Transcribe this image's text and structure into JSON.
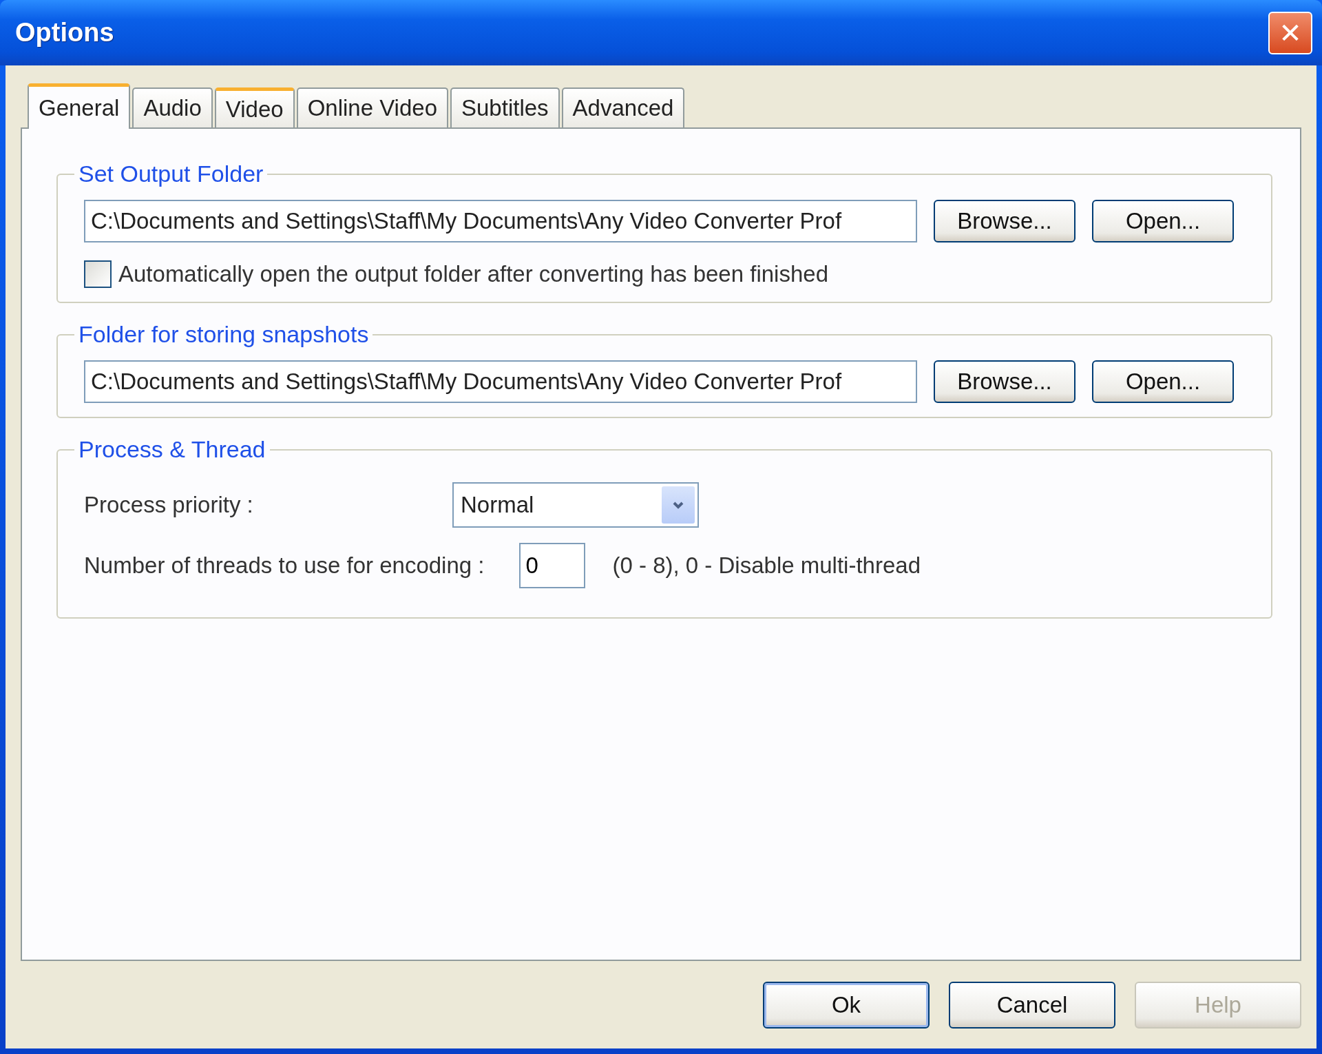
{
  "window": {
    "title": "Options",
    "close_label": "✕"
  },
  "tabs": [
    {
      "label": "General",
      "selected": true,
      "hover": false
    },
    {
      "label": "Audio",
      "selected": false,
      "hover": false
    },
    {
      "label": "Video",
      "selected": false,
      "hover": true
    },
    {
      "label": "Online Video",
      "selected": false,
      "hover": false
    },
    {
      "label": "Subtitles",
      "selected": false,
      "hover": false
    },
    {
      "label": "Advanced",
      "selected": false,
      "hover": false
    }
  ],
  "groups": [
    {
      "kind": "folder",
      "title": "Set Output Folder",
      "path": "C:\\Documents and Settings\\Staff\\My Documents\\Any Video Converter Prof",
      "buttons": [
        "Browse...",
        "Open..."
      ],
      "checkbox": {
        "label": "Automatically open the output folder after converting has been finished",
        "checked": false
      }
    },
    {
      "kind": "folder",
      "title": "Folder for storing snapshots",
      "path": "C:\\Documents and Settings\\Staff\\My Documents\\Any Video Converter Prof",
      "buttons": [
        "Browse...",
        "Open..."
      ]
    },
    {
      "kind": "process",
      "title": "Process & Thread",
      "priority_label": "Process priority :",
      "priority_value": "Normal",
      "threads_label": "Number of threads to use for encoding :",
      "threads_value": "0",
      "threads_hint": "(0 - 8), 0 - Disable multi-thread"
    }
  ],
  "buttons": [
    {
      "label": "Ok",
      "disabled": false,
      "default": true
    },
    {
      "label": "Cancel",
      "disabled": false,
      "default": false
    },
    {
      "label": "Help",
      "disabled": true,
      "default": false
    }
  ]
}
